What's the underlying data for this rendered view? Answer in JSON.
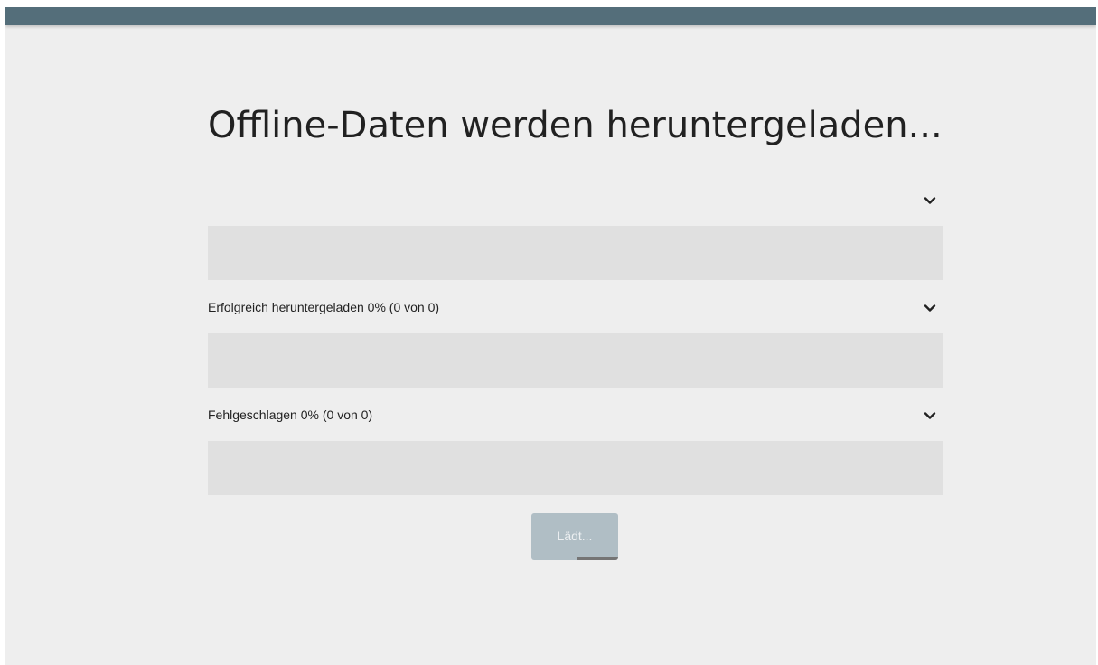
{
  "page": {
    "title": "Offline-Daten werden heruntergeladen..."
  },
  "sections": [
    {
      "label": "",
      "icon": "chevron-down-icon"
    },
    {
      "label": "Erfolgreich heruntergeladen 0% (0 von 0)",
      "icon": "chevron-down-icon"
    },
    {
      "label": "Fehlgeschlagen 0% (0 von 0)",
      "icon": "chevron-down-icon"
    }
  ],
  "button": {
    "label": "Lädt...",
    "state": "loading"
  },
  "colors": {
    "topbar": "#546e7a",
    "background": "#eeeeee",
    "panel": "#e0e0e0",
    "button": "#b0bec5",
    "progress": "#757575"
  }
}
